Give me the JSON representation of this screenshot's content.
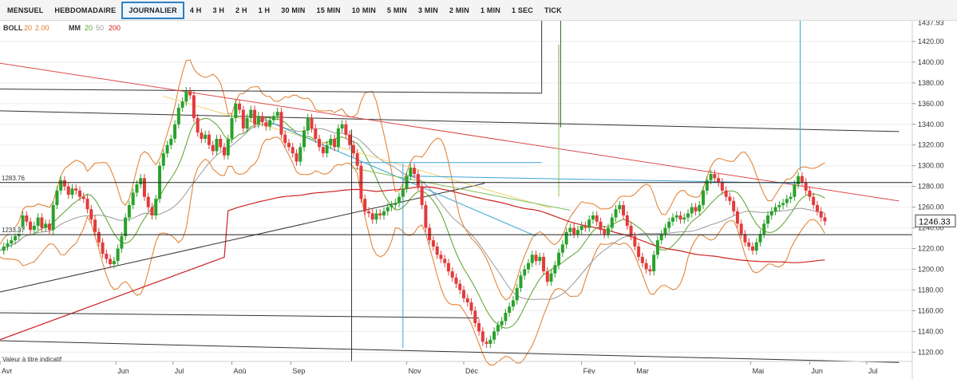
{
  "toolbar": {
    "tabs": [
      {
        "label": "MENSUEL",
        "active": false
      },
      {
        "label": "HEBDOMADAIRE",
        "active": false
      },
      {
        "label": "JOURNALIER",
        "active": true
      },
      {
        "label": "4 H",
        "active": false
      },
      {
        "label": "3 H",
        "active": false
      },
      {
        "label": "2 H",
        "active": false
      },
      {
        "label": "1 H",
        "active": false
      },
      {
        "label": "30 MIN",
        "active": false
      },
      {
        "label": "15 MIN",
        "active": false
      },
      {
        "label": "10 MIN",
        "active": false
      },
      {
        "label": "5 MIN",
        "active": false
      },
      {
        "label": "3 MIN",
        "active": false
      },
      {
        "label": "2 MIN",
        "active": false
      },
      {
        "label": "1 MIN",
        "active": false
      },
      {
        "label": "1 SEC",
        "active": false
      },
      {
        "label": "TICK",
        "active": false
      }
    ],
    "active_color": "#2e7fbf"
  },
  "chart_data": {
    "type": "candlestick",
    "indicators": {
      "boll": {
        "label": "BOLL",
        "period": "20",
        "dev": "2.00",
        "color": "#e07b2a"
      },
      "mm": {
        "label": "MM",
        "periods": [
          "20",
          "50",
          "200"
        ],
        "colors": [
          "#5aa02c",
          "#999999",
          "#cc2222"
        ]
      }
    },
    "footer_note": "Valeur à titre indicatif",
    "y_axis": {
      "ticks": [
        1120,
        1140,
        1160,
        1180,
        1200,
        1220,
        1240,
        1260,
        1280,
        1300,
        1320,
        1340,
        1360,
        1380,
        1400,
        1420
      ],
      "tick_labels": [
        "1120.00",
        "1140.00",
        "1160.00",
        "1180.00",
        "1200.00",
        "1220.00",
        "1240.00",
        "1260.00",
        "1280.00",
        "1300.00",
        "1320.00",
        "1340.00",
        "1360.00",
        "1380.00",
        "1400.00",
        "1420.00"
      ],
      "range": [
        1111,
        1440
      ],
      "top_label": "1437.93",
      "top_value": 1437.93
    },
    "x_axis": {
      "months": [
        {
          "label": "Avr",
          "day": 0
        },
        {
          "label": "Jun",
          "day": 61
        },
        {
          "label": "Jul",
          "day": 91
        },
        {
          "label": "Aoû",
          "day": 122
        },
        {
          "label": "Sep",
          "day": 153
        },
        {
          "label": "Nov",
          "day": 214
        },
        {
          "label": "Déc",
          "day": 244
        },
        {
          "label": "Fév",
          "day": 306
        },
        {
          "label": "Mar",
          "day": 334
        },
        {
          "label": "Mai",
          "day": 395
        },
        {
          "label": "Jun",
          "day": 426
        },
        {
          "label": "Jul",
          "day": 456
        }
      ],
      "range": [
        0,
        480
      ]
    },
    "last_price": {
      "value": 1246.33,
      "label": "1246.33"
    },
    "horizontal_levels": [
      {
        "value": 1283.76,
        "label": "1283.76",
        "color": "#222222"
      },
      {
        "value": 1233.37,
        "label": "1233.37",
        "color": "#222222"
      }
    ],
    "closes": [
      [
        0,
        1218
      ],
      [
        2,
        1222
      ],
      [
        4,
        1225
      ],
      [
        6,
        1228
      ],
      [
        8,
        1232
      ],
      [
        10,
        1238
      ],
      [
        12,
        1252
      ],
      [
        14,
        1246
      ],
      [
        16,
        1238
      ],
      [
        18,
        1242
      ],
      [
        20,
        1250
      ],
      [
        22,
        1240
      ],
      [
        24,
        1244
      ],
      [
        26,
        1238
      ],
      [
        28,
        1262
      ],
      [
        30,
        1276
      ],
      [
        32,
        1286
      ],
      [
        34,
        1280
      ],
      [
        36,
        1272
      ],
      [
        38,
        1278
      ],
      [
        40,
        1276
      ],
      [
        42,
        1270
      ],
      [
        44,
        1268
      ],
      [
        46,
        1258
      ],
      [
        48,
        1248
      ],
      [
        50,
        1236
      ],
      [
        52,
        1226
      ],
      [
        54,
        1215
      ],
      [
        56,
        1210
      ],
      [
        58,
        1205
      ],
      [
        60,
        1208
      ],
      [
        62,
        1220
      ],
      [
        64,
        1232
      ],
      [
        66,
        1250
      ],
      [
        68,
        1262
      ],
      [
        70,
        1274
      ],
      [
        72,
        1282
      ],
      [
        74,
        1288
      ],
      [
        76,
        1270
      ],
      [
        78,
        1260
      ],
      [
        80,
        1252
      ],
      [
        82,
        1268
      ],
      [
        84,
        1300
      ],
      [
        86,
        1312
      ],
      [
        88,
        1320
      ],
      [
        90,
        1326
      ],
      [
        92,
        1340
      ],
      [
        94,
        1356
      ],
      [
        96,
        1362
      ],
      [
        98,
        1372
      ],
      [
        100,
        1368
      ],
      [
        102,
        1346
      ],
      [
        104,
        1332
      ],
      [
        106,
        1326
      ],
      [
        108,
        1330
      ],
      [
        110,
        1320
      ],
      [
        112,
        1314
      ],
      [
        114,
        1326
      ],
      [
        116,
        1318
      ],
      [
        118,
        1310
      ],
      [
        120,
        1326
      ],
      [
        122,
        1346
      ],
      [
        124,
        1360
      ],
      [
        126,
        1354
      ],
      [
        128,
        1336
      ],
      [
        130,
        1346
      ],
      [
        132,
        1354
      ],
      [
        134,
        1340
      ],
      [
        136,
        1348
      ],
      [
        138,
        1342
      ],
      [
        140,
        1338
      ],
      [
        142,
        1344
      ],
      [
        144,
        1348
      ],
      [
        146,
        1352
      ],
      [
        148,
        1330
      ],
      [
        150,
        1322
      ],
      [
        152,
        1318
      ],
      [
        154,
        1312
      ],
      [
        156,
        1304
      ],
      [
        158,
        1318
      ],
      [
        160,
        1334
      ],
      [
        162,
        1346
      ],
      [
        164,
        1336
      ],
      [
        166,
        1326
      ],
      [
        168,
        1318
      ],
      [
        170,
        1312
      ],
      [
        172,
        1320
      ],
      [
        174,
        1326
      ],
      [
        176,
        1318
      ],
      [
        178,
        1336
      ],
      [
        180,
        1340
      ],
      [
        182,
        1330
      ],
      [
        184,
        1320
      ],
      [
        186,
        1312
      ],
      [
        188,
        1300
      ],
      [
        190,
        1268
      ],
      [
        192,
        1256
      ],
      [
        194,
        1254
      ],
      [
        196,
        1248
      ],
      [
        198,
        1254
      ],
      [
        200,
        1252
      ],
      [
        202,
        1256
      ],
      [
        204,
        1260
      ],
      [
        206,
        1262
      ],
      [
        208,
        1264
      ],
      [
        210,
        1270
      ],
      [
        212,
        1278
      ],
      [
        214,
        1290
      ],
      [
        216,
        1298
      ],
      [
        218,
        1292
      ],
      [
        220,
        1280
      ],
      [
        222,
        1262
      ],
      [
        224,
        1240
      ],
      [
        226,
        1228
      ],
      [
        228,
        1222
      ],
      [
        230,
        1214
      ],
      [
        232,
        1210
      ],
      [
        234,
        1206
      ],
      [
        236,
        1198
      ],
      [
        238,
        1192
      ],
      [
        240,
        1186
      ],
      [
        242,
        1180
      ],
      [
        244,
        1172
      ],
      [
        246,
        1168
      ],
      [
        248,
        1160
      ],
      [
        250,
        1148
      ],
      [
        252,
        1140
      ],
      [
        254,
        1130
      ],
      [
        256,
        1128
      ],
      [
        258,
        1132
      ],
      [
        260,
        1140
      ],
      [
        262,
        1146
      ],
      [
        264,
        1150
      ],
      [
        266,
        1158
      ],
      [
        268,
        1164
      ],
      [
        270,
        1170
      ],
      [
        272,
        1182
      ],
      [
        274,
        1194
      ],
      [
        276,
        1200
      ],
      [
        278,
        1206
      ],
      [
        280,
        1214
      ],
      [
        282,
        1208
      ],
      [
        284,
        1212
      ],
      [
        286,
        1198
      ],
      [
        288,
        1188
      ],
      [
        290,
        1196
      ],
      [
        292,
        1204
      ],
      [
        294,
        1216
      ],
      [
        296,
        1224
      ],
      [
        298,
        1236
      ],
      [
        300,
        1240
      ],
      [
        302,
        1234
      ],
      [
        304,
        1238
      ],
      [
        306,
        1242
      ],
      [
        308,
        1240
      ],
      [
        310,
        1248
      ],
      [
        312,
        1252
      ],
      [
        314,
        1246
      ],
      [
        316,
        1238
      ],
      [
        318,
        1234
      ],
      [
        320,
        1240
      ],
      [
        322,
        1250
      ],
      [
        324,
        1258
      ],
      [
        326,
        1262
      ],
      [
        328,
        1252
      ],
      [
        330,
        1242
      ],
      [
        332,
        1232
      ],
      [
        334,
        1222
      ],
      [
        336,
        1212
      ],
      [
        338,
        1206
      ],
      [
        340,
        1200
      ],
      [
        342,
        1198
      ],
      [
        344,
        1214
      ],
      [
        346,
        1228
      ],
      [
        348,
        1234
      ],
      [
        350,
        1240
      ],
      [
        352,
        1246
      ],
      [
        354,
        1250
      ],
      [
        356,
        1252
      ],
      [
        358,
        1248
      ],
      [
        360,
        1250
      ],
      [
        362,
        1254
      ],
      [
        364,
        1260
      ],
      [
        366,
        1256
      ],
      [
        368,
        1262
      ],
      [
        370,
        1276
      ],
      [
        372,
        1286
      ],
      [
        374,
        1292
      ],
      [
        376,
        1288
      ],
      [
        378,
        1284
      ],
      [
        380,
        1276
      ],
      [
        382,
        1270
      ],
      [
        384,
        1266
      ],
      [
        386,
        1256
      ],
      [
        388,
        1244
      ],
      [
        390,
        1234
      ],
      [
        392,
        1226
      ],
      [
        394,
        1222
      ],
      [
        396,
        1218
      ],
      [
        398,
        1226
      ],
      [
        400,
        1234
      ],
      [
        402,
        1244
      ],
      [
        404,
        1252
      ],
      [
        406,
        1256
      ],
      [
        408,
        1260
      ],
      [
        410,
        1262
      ],
      [
        412,
        1264
      ],
      [
        414,
        1268
      ],
      [
        416,
        1270
      ],
      [
        418,
        1282
      ],
      [
        420,
        1290
      ],
      [
        422,
        1284
      ],
      [
        424,
        1276
      ],
      [
        426,
        1270
      ],
      [
        428,
        1262
      ],
      [
        430,
        1256
      ],
      [
        432,
        1250
      ],
      [
        434,
        1246.33
      ]
    ],
    "annotations": [
      {
        "type": "line",
        "from": [
          0,
          1353
        ],
        "to": [
          473,
          1333
        ],
        "color": "#333333"
      },
      {
        "type": "line",
        "from": [
          0,
          1374
        ],
        "to": [
          285,
          1370
        ],
        "color": "#333333"
      },
      {
        "type": "line",
        "from": [
          285,
          1370
        ],
        "to": [
          285,
          1440
        ],
        "color": "#333333"
      },
      {
        "type": "line",
        "from": [
          0,
          1158
        ],
        "to": [
          252,
          1153
        ],
        "color": "#333333"
      },
      {
        "type": "line",
        "from": [
          0,
          1131
        ],
        "to": [
          473,
          1110
        ],
        "color": "#333333"
      },
      {
        "type": "line",
        "from": [
          0,
          1178
        ],
        "to": [
          255,
          1283
        ],
        "color": "#333333"
      },
      {
        "type": "line",
        "from": [
          0,
          1399
        ],
        "to": [
          473,
          1266
        ],
        "color": "#dd4a4a"
      },
      {
        "type": "line",
        "from": [
          86,
          1367
        ],
        "to": [
          290,
          1259
        ],
        "color": "#f0d272"
      },
      {
        "type": "line",
        "from": [
          132,
          1350
        ],
        "to": [
          282,
          1232
        ],
        "color": "#3aa3d8"
      },
      {
        "type": "line",
        "from": [
          215,
          1290
        ],
        "to": [
          421,
          1283
        ],
        "color": "#3aa3d8"
      },
      {
        "type": "line",
        "from": [
          212,
          1302
        ],
        "to": [
          212,
          1124
        ],
        "color": "#3aa3d8"
      },
      {
        "type": "line",
        "from": [
          421,
          1440
        ],
        "to": [
          421,
          1295
        ],
        "color": "#3aa3d8"
      },
      {
        "type": "line",
        "from": [
          185,
          1303
        ],
        "to": [
          285,
          1303
        ],
        "color": "#3aa3d8"
      },
      {
        "type": "line",
        "from": [
          185,
          1298
        ],
        "to": [
          300,
          1257
        ],
        "color": "#7fbf5a"
      },
      {
        "type": "line",
        "from": [
          185,
          1335
        ],
        "to": [
          185,
          1111
        ],
        "color": "#333333"
      },
      {
        "type": "line",
        "from": [
          295,
          1440
        ],
        "to": [
          295,
          1337
        ],
        "color": "#2e6b2e"
      },
      {
        "type": "line",
        "from": [
          294,
          1417
        ],
        "to": [
          294,
          1337
        ],
        "color": "#7f9f4a"
      },
      {
        "type": "line",
        "from": [
          294,
          1337
        ],
        "to": [
          294,
          1270
        ],
        "color": "#8fc35a"
      }
    ]
  }
}
